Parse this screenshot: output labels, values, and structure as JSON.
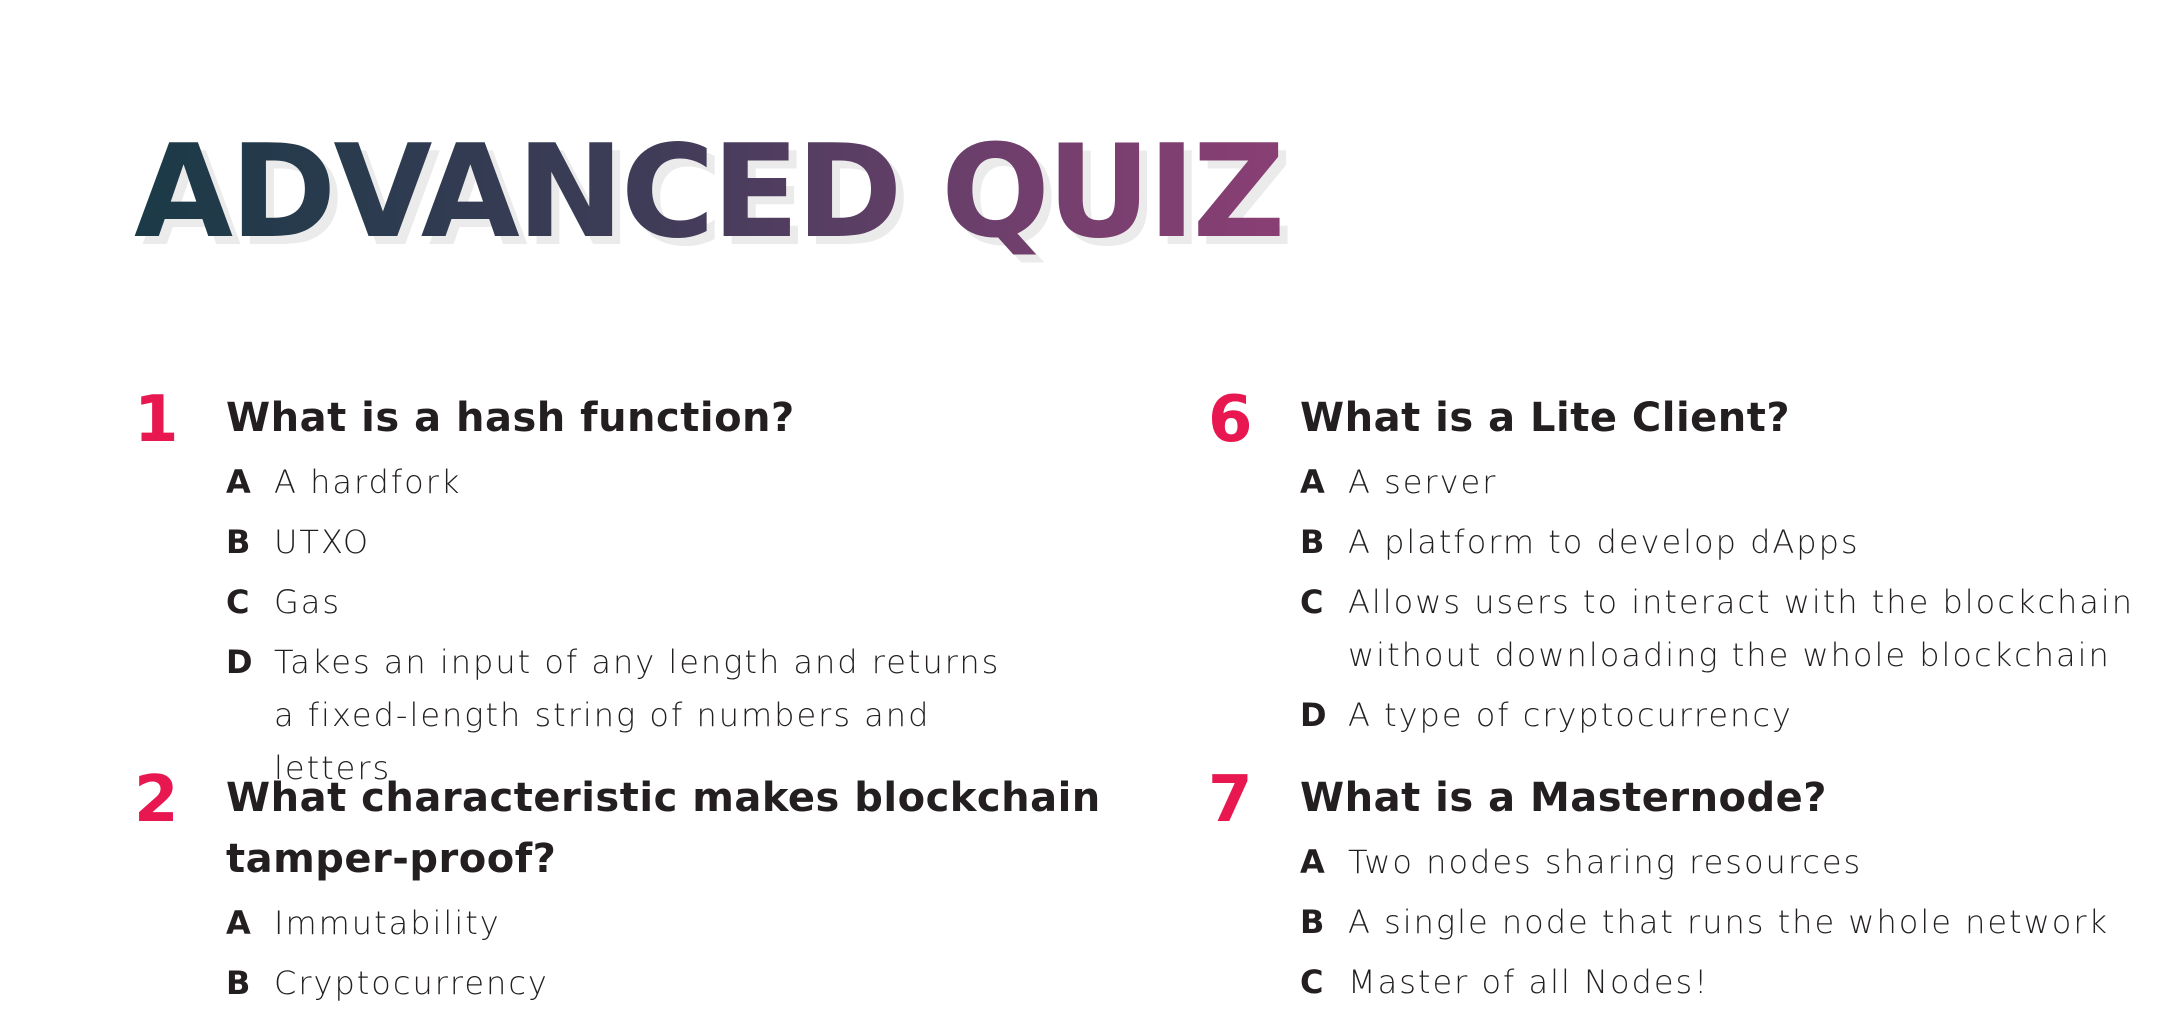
{
  "title": "ADVANCED QUIZ",
  "colors": {
    "title_gradient_start": "#1b3a47",
    "title_gradient_end": "#8a3f74",
    "number_accent": "#e8174f",
    "text": "#231f20"
  },
  "questions": [
    {
      "number": "1",
      "text": "What is a hash function?",
      "answers": [
        {
          "letter": "A",
          "text": "A hardfork"
        },
        {
          "letter": "B",
          "text": "UTXO"
        },
        {
          "letter": "C",
          "text": "Gas"
        },
        {
          "letter": "D",
          "text": "Takes an input of any length and returns a fixed-length string of numbers and letters"
        }
      ]
    },
    {
      "number": "2",
      "text": "What characteristic makes blockchain tamper-proof?",
      "answers": [
        {
          "letter": "A",
          "text": "Immutability"
        },
        {
          "letter": "B",
          "text": "Cryptocurrency"
        }
      ]
    },
    {
      "number": "6",
      "text": "What is a Lite Client?",
      "answers": [
        {
          "letter": "A",
          "text": "A server"
        },
        {
          "letter": "B",
          "text": "A platform to develop dApps"
        },
        {
          "letter": "C",
          "text": "Allows users to interact with the blockchain without downloading the whole blockchain"
        },
        {
          "letter": "D",
          "text": "A type of cryptocurrency"
        }
      ]
    },
    {
      "number": "7",
      "text": "What is a Masternode?",
      "answers": [
        {
          "letter": "A",
          "text": "Two nodes sharing resources"
        },
        {
          "letter": "B",
          "text": "A single node that runs the whole network"
        },
        {
          "letter": "C",
          "text": "Master of all Nodes!"
        }
      ]
    }
  ]
}
